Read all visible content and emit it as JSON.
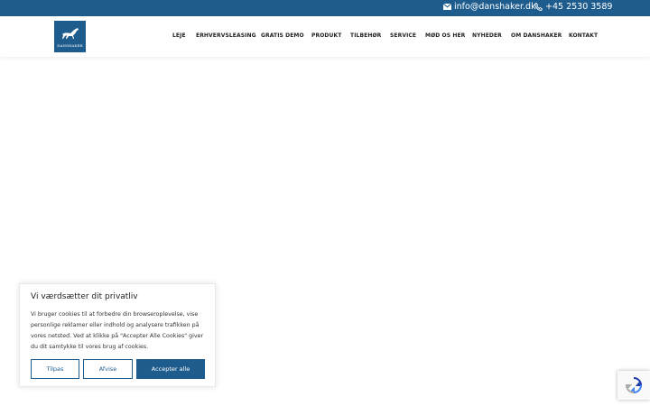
{
  "topbar": {
    "email": "info@danshaker.dk",
    "phone": "+45 2530 3589"
  },
  "logo": {
    "text": "DANSHAKER"
  },
  "nav": {
    "items": [
      "LEJE",
      "ERHVERVSLEASING",
      "GRATIS DEMO",
      "PRODUKT",
      "TILBEHØR",
      "SERVICE",
      "MØD OS HER",
      "NYHEDER",
      "OM DANSHAKER",
      "KONTAKT"
    ]
  },
  "cookie": {
    "title": "Vi værdsætter dit privatliv",
    "body": "Vi bruger cookies til at forbedre din browseroplevelse, vise personlige reklamer eller indhold og analysere trafikken på vores netsted. Ved at klikke på \"Accepter Alle Cookies\" giver du dit samtykke til vores brug af cookies.",
    "customize_label": "Tilpas",
    "reject_label": "Afvise",
    "accept_label": "Accepter alle"
  },
  "colors": {
    "brand": "#1e5c8e"
  },
  "icons": {
    "email": "envelope-icon",
    "phone": "phone-icon",
    "recaptcha": "recaptcha-icon"
  }
}
